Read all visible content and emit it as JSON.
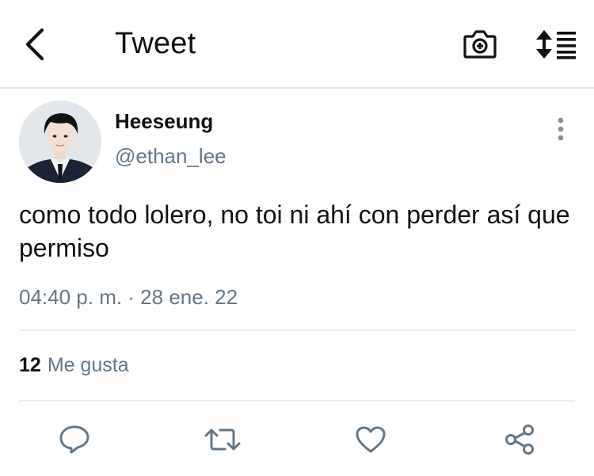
{
  "header": {
    "title": "Tweet",
    "back_icon": "chevron-left-icon",
    "camera_icon": "camera-add-icon",
    "sort_icon": "sort-list-icon"
  },
  "tweet": {
    "display_name": "Heeseung",
    "handle": "@ethan_lee",
    "text": "como todo lolero, no toi ni ahí con perder así que permiso",
    "timestamp": "04:40 p. m. · 28 ene. 22",
    "likes_count": "12",
    "likes_label": "Me gusta"
  },
  "actions": [
    {
      "icon": "reply-icon"
    },
    {
      "icon": "retweet-icon"
    },
    {
      "icon": "like-icon"
    },
    {
      "icon": "share-icon"
    }
  ],
  "colors": {
    "text_primary": "#111111",
    "text_secondary": "#657786",
    "divider": "#e6ecf0",
    "icon": "#657786"
  }
}
